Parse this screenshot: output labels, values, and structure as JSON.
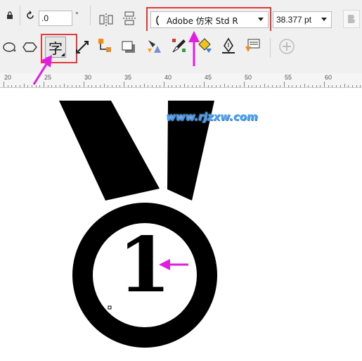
{
  "property_bar": {
    "rotation_value": ".0",
    "degree_symbol": "°",
    "font_name": "Adobe 仿宋 Std R",
    "font_size": "38.377 pt",
    "bold_icon": "bold-icon"
  },
  "toolbar": {
    "text_tool_glyph": "字"
  },
  "ruler": {
    "labels": [
      "20",
      "25",
      "30",
      "35",
      "40",
      "45",
      "50",
      "55",
      "60"
    ]
  },
  "canvas": {
    "watermark": "www.rjzxw.com",
    "numeral": "1"
  },
  "colors": {
    "accent_annotation": "#e03a3a",
    "arrow": "#e01de0",
    "watermark": "#3aa0ff"
  }
}
